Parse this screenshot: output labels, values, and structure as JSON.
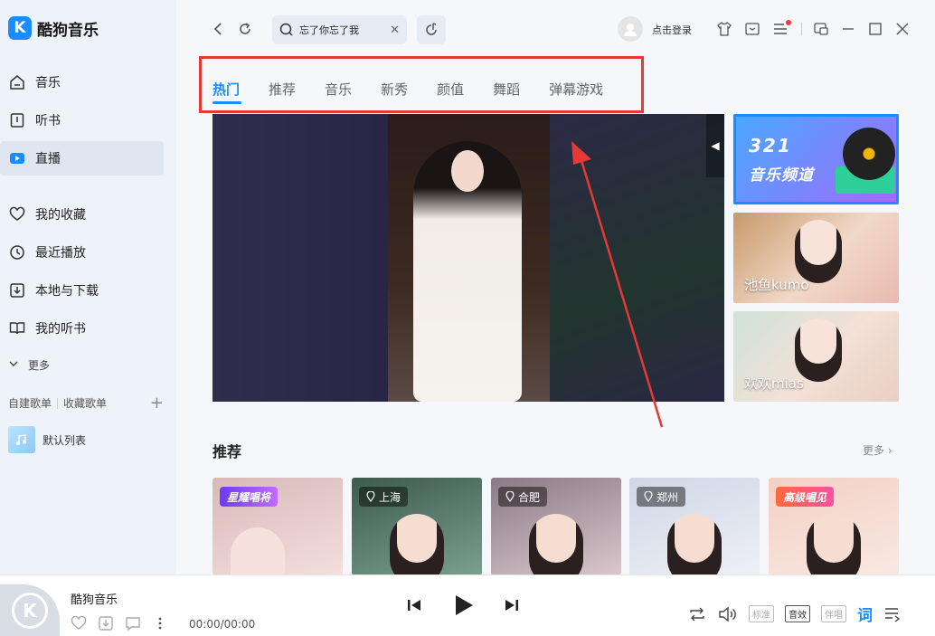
{
  "app": {
    "name": "酷狗音乐",
    "logo_letter": "K"
  },
  "sidebar": {
    "items": [
      {
        "label": "音乐",
        "icon": "home-icon",
        "active": false
      },
      {
        "label": "听书",
        "icon": "book-icon",
        "active": false
      },
      {
        "label": "直播",
        "icon": "live-icon",
        "active": true
      },
      {
        "label": "我的收藏",
        "icon": "heart-icon",
        "active": false
      },
      {
        "label": "最近播放",
        "icon": "clock-icon",
        "active": false
      },
      {
        "label": "本地与下载",
        "icon": "download-icon",
        "active": false
      },
      {
        "label": "我的听书",
        "icon": "open-book-icon",
        "active": false
      }
    ],
    "more_label": "更多",
    "playlist_tabs": [
      "自建歌单",
      "收藏歌单"
    ],
    "default_list": "默认列表"
  },
  "topbar": {
    "search_value": "忘了你忘了我",
    "login_label": "点击登录"
  },
  "tabs": [
    "热门",
    "推荐",
    "音乐",
    "新秀",
    "颜值",
    "舞蹈",
    "弹幕游戏"
  ],
  "side_cards": {
    "card1_line1": "321",
    "card1_line2": "音乐频道",
    "card2_name": "池鱼kumo",
    "card3_name": "欢欢mias"
  },
  "recommend": {
    "title": "推荐",
    "more": "更多",
    "cards": [
      {
        "tag": "星耀唱将"
      },
      {
        "tag": "上海"
      },
      {
        "tag": "合肥"
      },
      {
        "tag": "郑州"
      },
      {
        "tag": "高级唱见"
      }
    ]
  },
  "player": {
    "song_title": "酷狗音乐",
    "time": "00:00/00:00",
    "quality_labels": [
      "标准",
      "音效",
      "伴唱"
    ],
    "lyrics_label": "词"
  },
  "colors": {
    "accent": "#1a8cff",
    "highlight_box": "#e53935",
    "arrow": "#e53935"
  }
}
